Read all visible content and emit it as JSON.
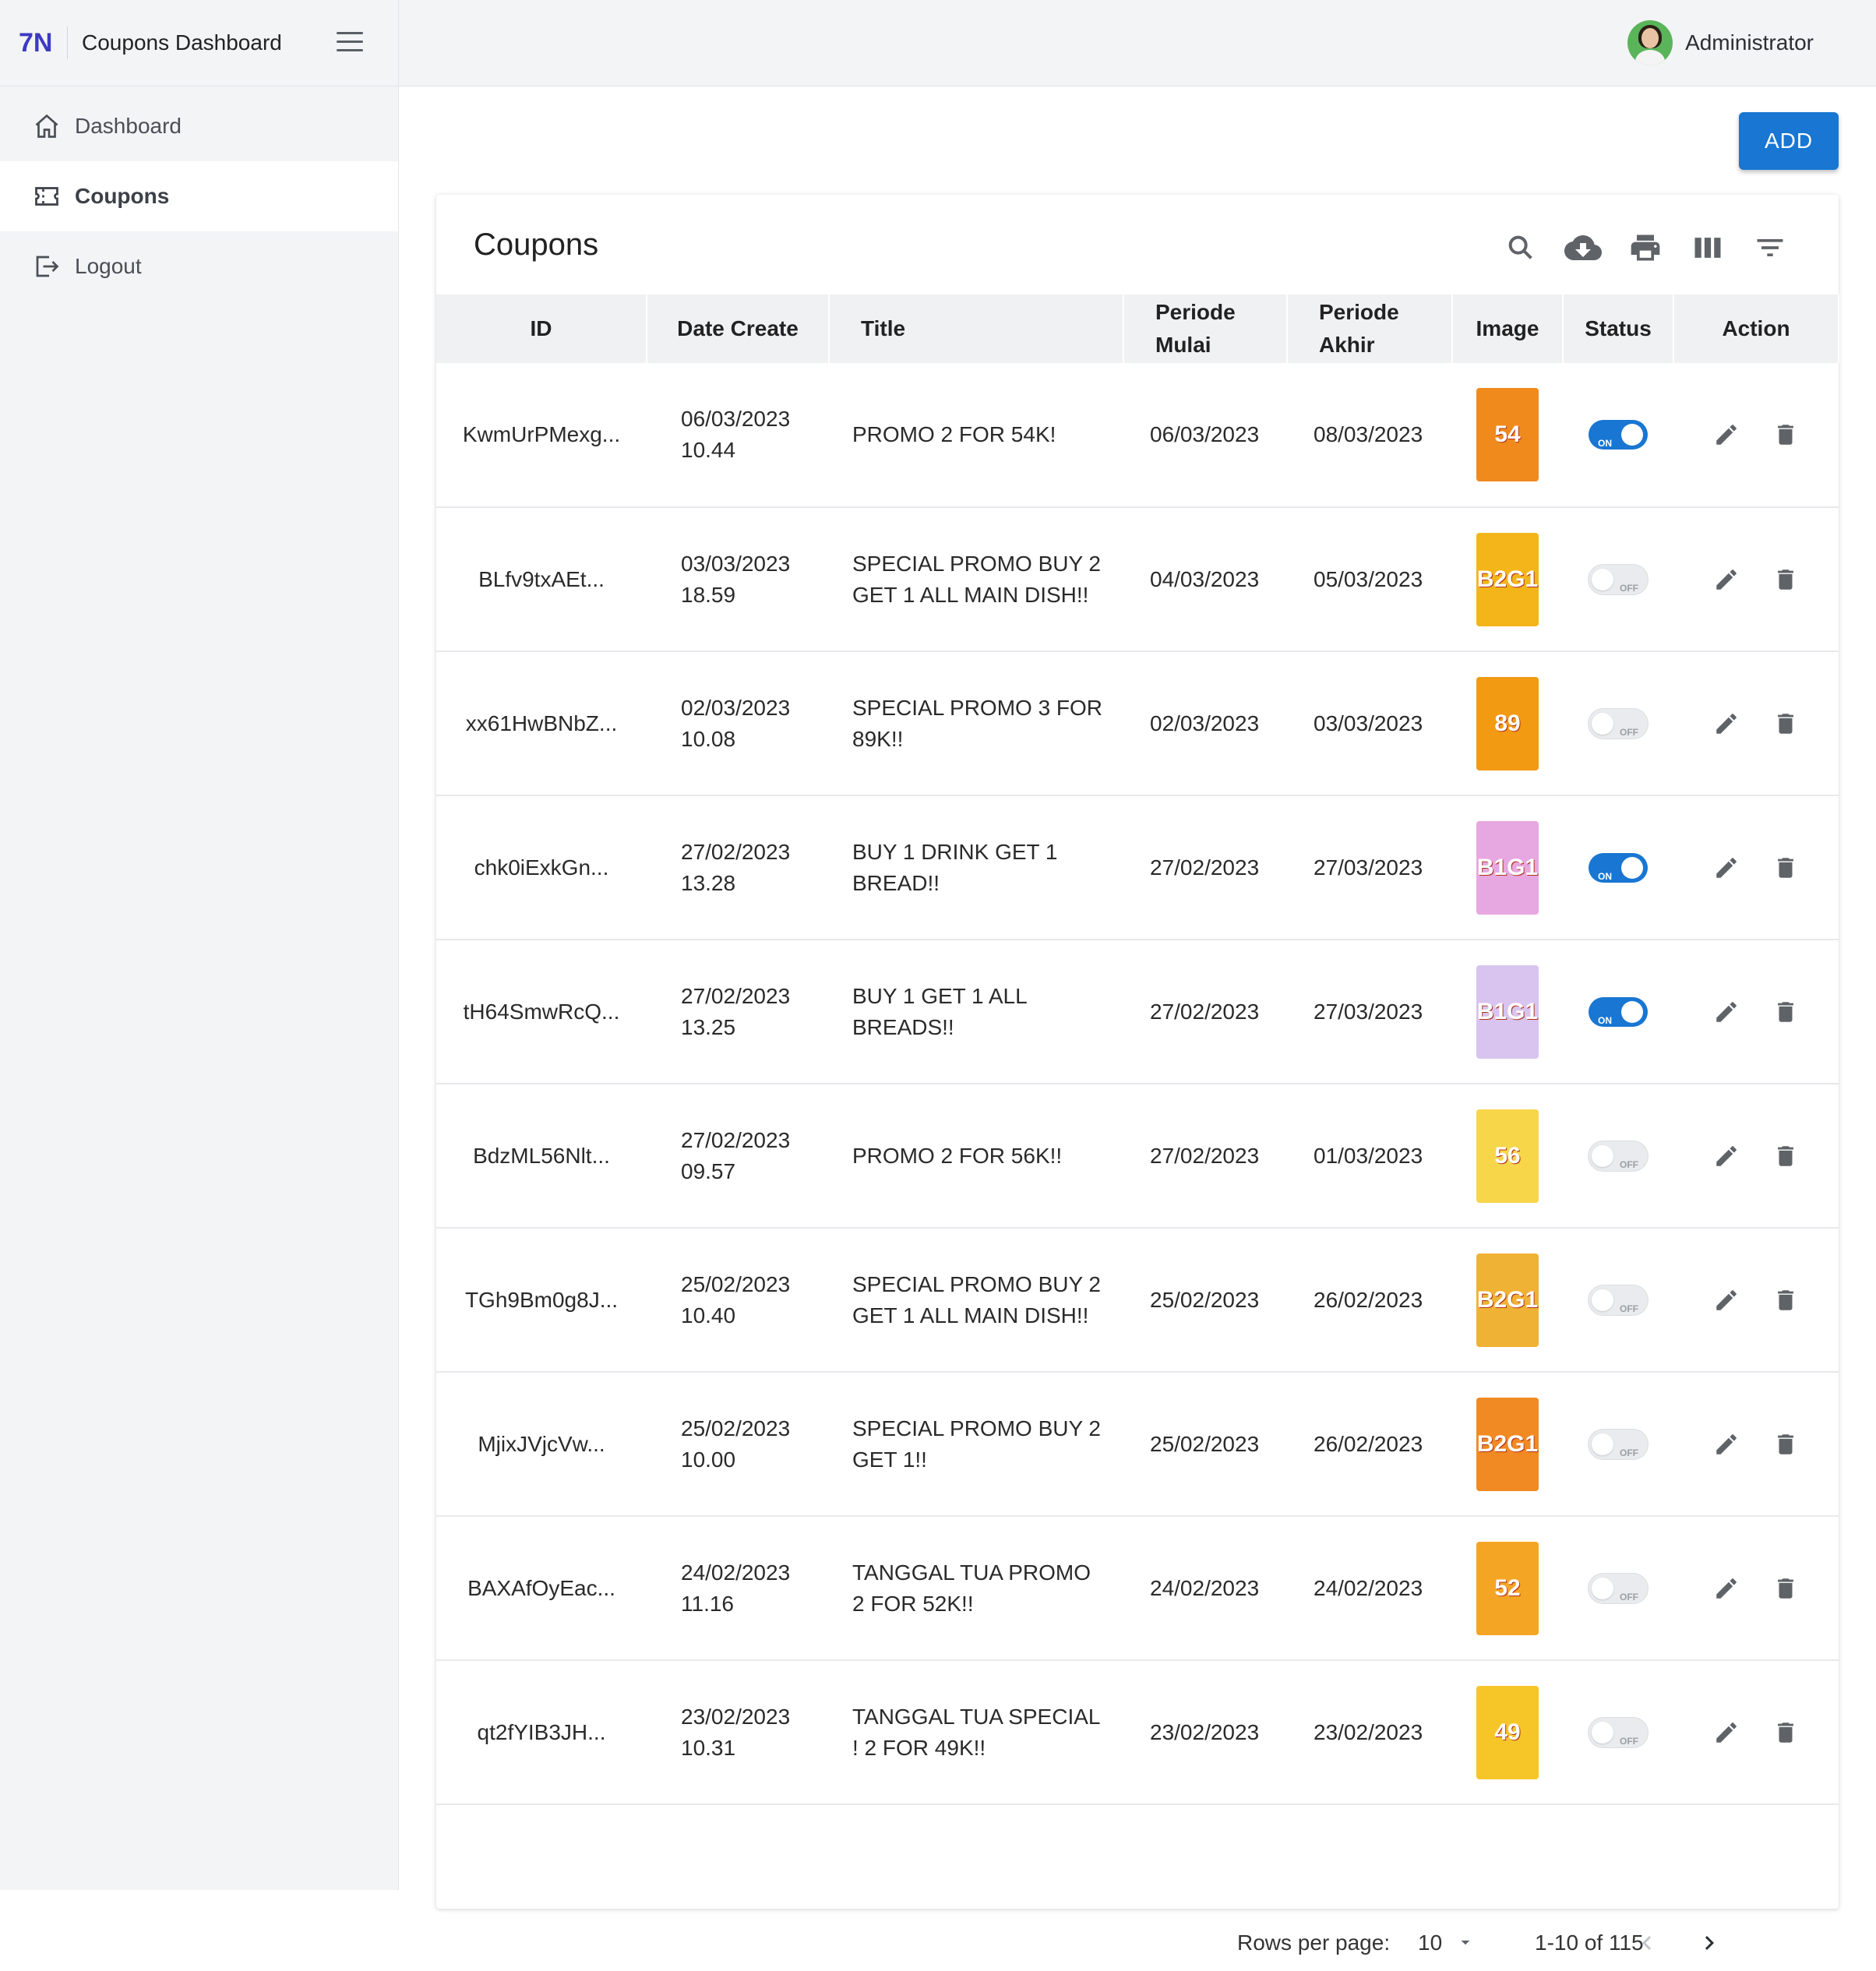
{
  "app": {
    "logo": "7N",
    "title": "Coupons Dashboard"
  },
  "user": {
    "name": "Administrator"
  },
  "sidebar": {
    "items": [
      {
        "label": "Dashboard",
        "icon": "home-icon",
        "active": false
      },
      {
        "label": "Coupons",
        "icon": "ticket-icon",
        "active": true
      },
      {
        "label": "Logout",
        "icon": "logout-icon",
        "active": false
      }
    ]
  },
  "main": {
    "add_label": "ADD",
    "card_title": "Coupons",
    "toolbar": [
      "search-icon",
      "cloud-download-icon",
      "print-icon",
      "view-column-icon",
      "filter-list-icon"
    ],
    "columns": {
      "id": "ID",
      "date_create": "Date Create",
      "title": "Title",
      "periode_mulai_1": "Periode",
      "periode_mulai_2": "Mulai",
      "periode_akhir_1": "Periode",
      "periode_akhir_2": "Akhir",
      "image": "Image",
      "status": "Status",
      "action": "Action"
    },
    "rows": [
      {
        "id": "KwmUrPMexg...",
        "date": "06/03/2023",
        "time": "10.44",
        "title": "PROMO 2 FOR 54K!",
        "mulai": "06/03/2023",
        "akhir": "08/03/2023",
        "thumb_text": "54",
        "thumb_color": "#f08a1c",
        "status": "ON"
      },
      {
        "id": "BLfv9txAEt...",
        "date": "03/03/2023",
        "time": "18.59",
        "title": "SPECIAL PROMO BUY 2 GET 1 ALL MAIN DISH!!",
        "mulai": "04/03/2023",
        "akhir": "05/03/2023",
        "thumb_text": "B2G1",
        "thumb_color": "#f3b51a",
        "status": "OFF"
      },
      {
        "id": "xx61HwBNbZ...",
        "date": "02/03/2023",
        "time": "10.08",
        "title": "SPECIAL PROMO 3 FOR 89K!!",
        "mulai": "02/03/2023",
        "akhir": "03/03/2023",
        "thumb_text": "89",
        "thumb_color": "#f29a12",
        "status": "OFF"
      },
      {
        "id": "chk0iExkGn...",
        "date": "27/02/2023",
        "time": "13.28",
        "title": "BUY 1 DRINK GET 1 BREAD!!",
        "mulai": "27/02/2023",
        "akhir": "27/03/2023",
        "thumb_text": "B1G1",
        "thumb_color": "#e7a7e0",
        "status": "ON"
      },
      {
        "id": "tH64SmwRcQ...",
        "date": "27/02/2023",
        "time": "13.25",
        "title": "BUY 1 GET 1 ALL BREADS!!",
        "mulai": "27/02/2023",
        "akhir": "27/03/2023",
        "thumb_text": "B1G1",
        "thumb_color": "#d9c4ef",
        "status": "ON"
      },
      {
        "id": "BdzML56Nlt...",
        "date": "27/02/2023",
        "time": "09.57",
        "title": "PROMO 2 FOR 56K!!",
        "mulai": "27/02/2023",
        "akhir": "01/03/2023",
        "thumb_text": "56",
        "thumb_color": "#f7d64a",
        "status": "OFF"
      },
      {
        "id": "TGh9Bm0g8J...",
        "date": "25/02/2023",
        "time": "10.40",
        "title": "SPECIAL PROMO BUY 2 GET 1 ALL MAIN DISH!!",
        "mulai": "25/02/2023",
        "akhir": "26/02/2023",
        "thumb_text": "B2G1",
        "thumb_color": "#f0b234",
        "status": "OFF"
      },
      {
        "id": "MjixJVjcVw...",
        "date": "25/02/2023",
        "time": "10.00",
        "title": "SPECIAL PROMO BUY 2 GET 1!!",
        "mulai": "25/02/2023",
        "akhir": "26/02/2023",
        "thumb_text": "B2G1",
        "thumb_color": "#f18a22",
        "status": "OFF"
      },
      {
        "id": "BAXAfOyEac...",
        "date": "24/02/2023",
        "time": "11.16",
        "title": "TANGGAL TUA PROMO 2 FOR 52K!!",
        "mulai": "24/02/2023",
        "akhir": "24/02/2023",
        "thumb_text": "52",
        "thumb_color": "#f5a524",
        "status": "OFF"
      },
      {
        "id": "qt2fYIB3JH...",
        "date": "23/02/2023",
        "time": "10.31",
        "title": "TANGGAL TUA SPECIAL ! 2 FOR 49K!!",
        "mulai": "23/02/2023",
        "akhir": "23/02/2023",
        "thumb_text": "49",
        "thumb_color": "#f6c628",
        "status": "OFF"
      }
    ],
    "pagination": {
      "rows_per_page_label": "Rows per page:",
      "rows_per_page": "10",
      "range": "1-10 of 115"
    }
  }
}
